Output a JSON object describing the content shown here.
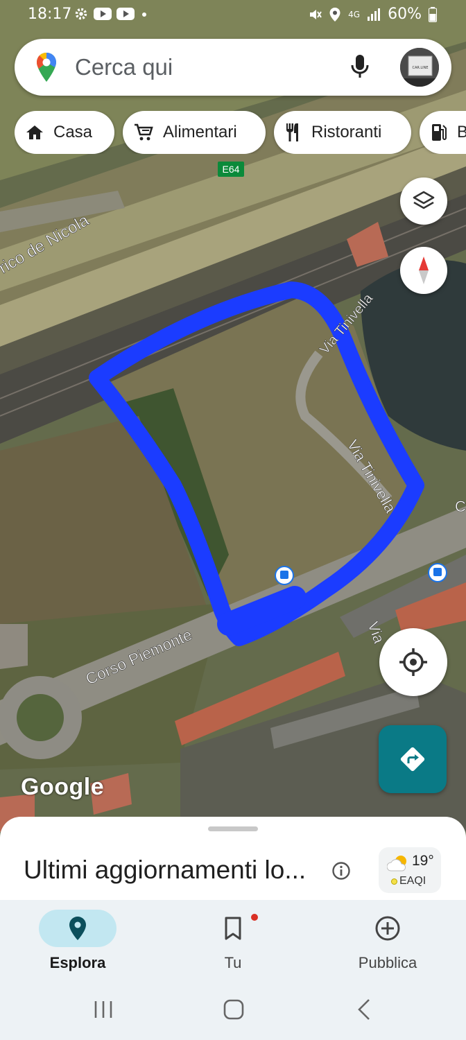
{
  "status_bar": {
    "time": "18:17",
    "network": "4G",
    "battery": "60%",
    "icons": [
      "settings-icon",
      "youtube-icon",
      "youtube-icon",
      "dot-icon",
      "mute-icon",
      "location-icon",
      "signal-icon",
      "battery-icon"
    ]
  },
  "search": {
    "placeholder": "Cerca qui",
    "avatar_text": "CAR.LINE"
  },
  "chips": [
    {
      "label": "Casa",
      "icon": "home-icon"
    },
    {
      "label": "Alimentari",
      "icon": "cart-icon"
    },
    {
      "label": "Ristoranti",
      "icon": "restaurant-icon"
    },
    {
      "label": "B",
      "icon": "fuel-icon"
    }
  ],
  "map": {
    "road_shield": "E64",
    "street_labels": {
      "de_nicola": "rico de Nicola",
      "tinivella_top": "Via Tinivella",
      "tinivella": "Via Tinivella",
      "corso_piemonte": "Corso Piemonte",
      "via_right": "Via",
      "c_right": "C"
    },
    "outline_color": "#1b3cff",
    "attribution": "Google"
  },
  "sheet": {
    "title": "Ultimi aggiornamenti lo...",
    "weather": {
      "temp": "19°",
      "aqi": "EAQI"
    }
  },
  "bottom_nav": [
    {
      "label": "Esplora",
      "icon": "explore-pin-icon",
      "active": true
    },
    {
      "label": "Tu",
      "icon": "bookmark-icon",
      "active": false
    },
    {
      "label": "Pubblica",
      "icon": "add-circle-icon",
      "active": false
    }
  ],
  "colors": {
    "accent": "#0a7a86",
    "active_pill": "#c2e7f1",
    "outline": "#1b3cff"
  }
}
